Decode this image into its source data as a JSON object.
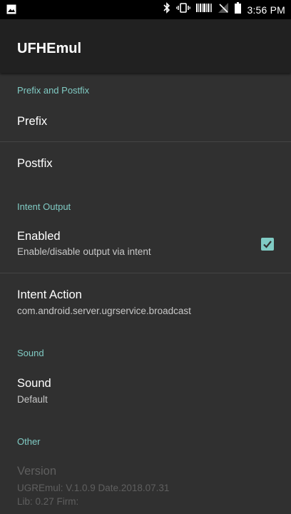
{
  "status_bar": {
    "time": "3:56 PM",
    "icons": [
      "image-notification-icon",
      "bluetooth-icon",
      "vibrate-icon",
      "barcode-icon",
      "no-signal-icon",
      "battery-icon"
    ]
  },
  "app": {
    "title": "UFHEmul"
  },
  "preferences": {
    "cat_prefix_postfix": "Prefix and Postfix",
    "prefix_title": "Prefix",
    "postfix_title": "Postfix",
    "cat_intent_output": "Intent Output",
    "enabled_title": "Enabled",
    "enabled_summary": "Enable/disable output via intent",
    "enabled_checked": true,
    "intent_action_title": "Intent Action",
    "intent_action_summary": "com.android.server.ugrservice.broadcast",
    "cat_sound": "Sound",
    "sound_title": "Sound",
    "sound_summary": "Default",
    "cat_other": "Other",
    "version_title": "Version",
    "version_line1": "UGREmul: V.1.0.9 Date.2018.07.31",
    "version_line2": "Lib: 0.27 Firm:"
  },
  "colors": {
    "accent": "#80cbc4",
    "background": "#303030",
    "appbar": "#212121",
    "status_bar": "#000000"
  }
}
